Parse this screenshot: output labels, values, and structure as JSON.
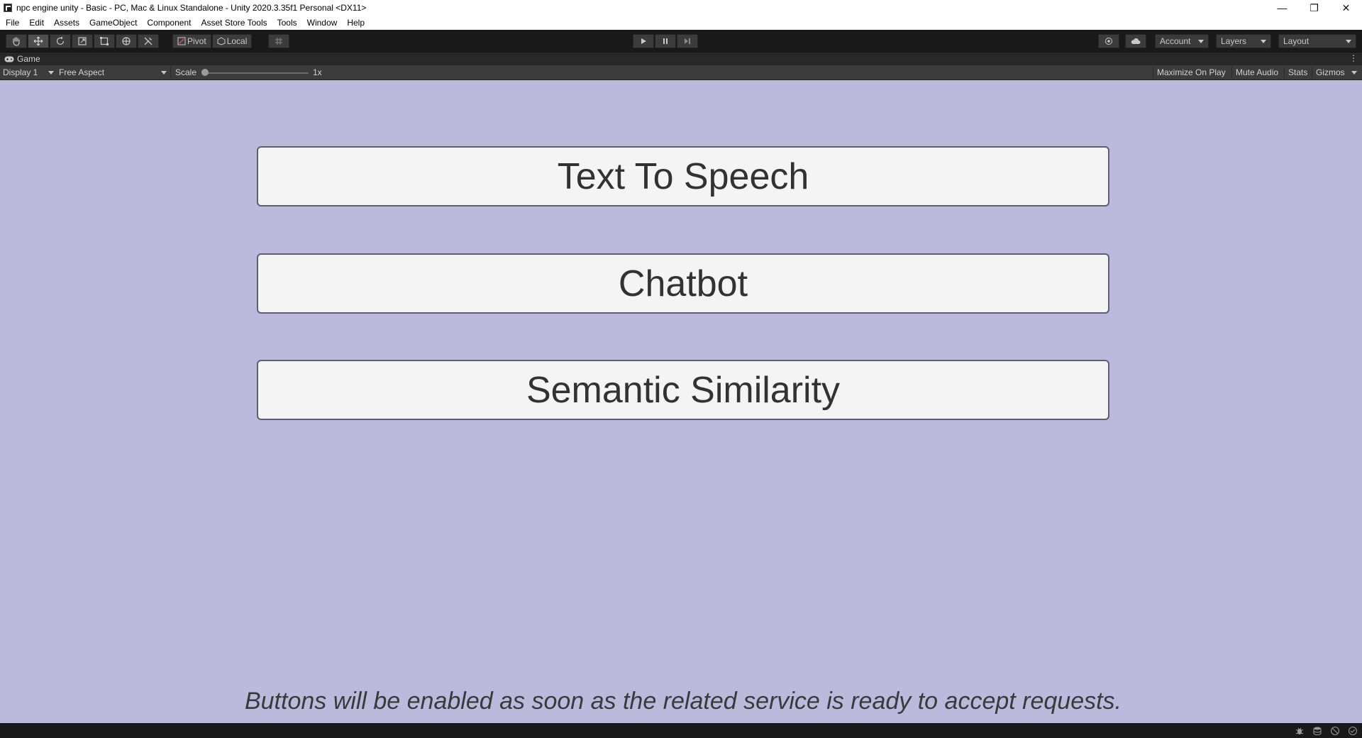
{
  "window": {
    "title": "npc engine unity - Basic - PC, Mac & Linux Standalone - Unity 2020.3.35f1 Personal <DX11>",
    "minimize_glyph": "—",
    "restore_glyph": "❐",
    "close_glyph": "✕"
  },
  "menu": [
    "File",
    "Edit",
    "Assets",
    "GameObject",
    "Component",
    "Asset Store Tools",
    "Tools",
    "Window",
    "Help"
  ],
  "toolbar": {
    "pivot_label": "Pivot",
    "local_label": "Local",
    "account_label": "Account",
    "layers_label": "Layers",
    "layout_label": "Layout"
  },
  "game_tab": {
    "label": "Game",
    "kebab": "⋮"
  },
  "game_controls": {
    "display": "Display 1",
    "aspect": "Free Aspect",
    "scale_label": "Scale",
    "scale_value": "1x",
    "maximize_on_play": "Maximize On Play",
    "mute_audio": "Mute Audio",
    "stats": "Stats",
    "gizmos": "Gizmos"
  },
  "game_view": {
    "background": "#bcbadc",
    "buttons": [
      "Text To Speech",
      "Chatbot",
      "Semantic Similarity"
    ],
    "notice": "Buttons will be enabled as soon as the related service is ready to accept requests."
  }
}
